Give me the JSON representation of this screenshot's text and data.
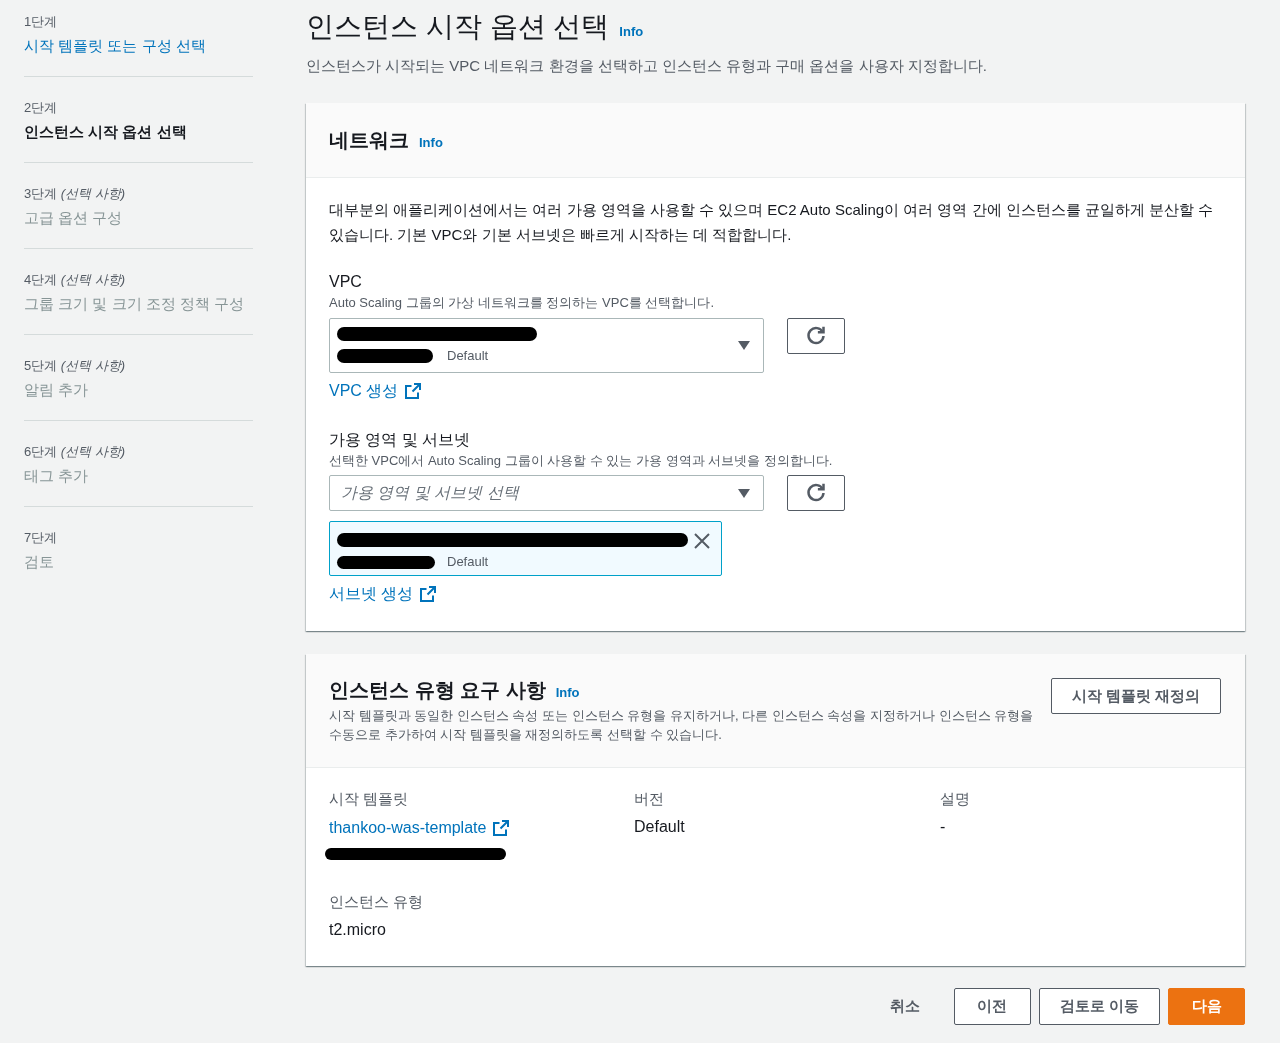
{
  "steps": [
    {
      "label": "1단계",
      "title": "시작 템플릿 또는 구성 선택",
      "selected": false,
      "disabled": false
    },
    {
      "label": "2단계",
      "title": "인스턴스 시작 옵션 선택",
      "selected": true,
      "disabled": false
    },
    {
      "label": "3단계",
      "optional_note": "(선택 사항)",
      "title": "고급 옵션 구성",
      "selected": false,
      "disabled": true
    },
    {
      "label": "4단계",
      "optional_note": "(선택 사항)",
      "title": "그룹 크기 및 크기 조정 정책 구성",
      "selected": false,
      "disabled": true
    },
    {
      "label": "5단계",
      "optional_note": "(선택 사항)",
      "title": "알림 추가",
      "selected": false,
      "disabled": true
    },
    {
      "label": "6단계",
      "optional_note": "(선택 사항)",
      "title": "태그 추가",
      "selected": false,
      "disabled": true
    },
    {
      "label": "7단계",
      "title": "검토",
      "selected": false,
      "disabled": true
    }
  ],
  "page": {
    "title": "인스턴스 시작 옵션 선택",
    "info": "Info",
    "description": "인스턴스가 시작되는 VPC 네트워크 환경을 선택하고 인스턴스 유형과 구매 옵션을 사용자 지정합니다."
  },
  "network": {
    "title": "네트워크",
    "info": "Info",
    "description": "대부분의 애플리케이션에서는 여러 가용 영역을 사용할 수 있으며 EC2 Auto Scaling이 여러 영역 간에 인스턴스를 균일하게 분산할 수 있습니다. 기본 VPC와 기본 서브넷은 빠르게 시작하는 데 적합합니다.",
    "vpc": {
      "label": "VPC",
      "description": "Auto Scaling 그룹의 가상 네트워크를 정의하는 VPC를 선택합니다.",
      "value_tag": "Default",
      "redacted": true,
      "create_link": "VPC 생성"
    },
    "subnets": {
      "label": "가용 영역 및 서브넷",
      "description": "선택한 VPC에서 Auto Scaling 그룹이 사용할 수 있는 가용 영역과 서브넷을 정의합니다.",
      "placeholder": "가용 영역 및 서브넷 선택",
      "selected": [
        {
          "tag": "Default",
          "redacted": true
        }
      ],
      "create_link": "서브넷 생성"
    }
  },
  "instance_type": {
    "title": "인스턴스 유형 요구 사항",
    "info": "Info",
    "description": "시작 템플릿과 동일한 인스턴스 속성 또는 인스턴스 유형을 유지하거나, 다른 인스턴스 속성을 지정하거나 인스턴스 유형을 수동으로 추가하여 시작 템플릿을 재정의하도록 선택할 수 있습니다.",
    "override_button": "시작 템플릿 재정의",
    "fields": [
      {
        "label": "시작 템플릿",
        "value": "thankoo-was-template",
        "kind": "link",
        "redacted_note": true
      },
      {
        "label": "버전",
        "value": "Default",
        "kind": "text"
      },
      {
        "label": "설명",
        "value": "-",
        "kind": "text"
      }
    ],
    "type_field": {
      "label": "인스턴스 유형",
      "value": "t2.micro"
    }
  },
  "footer": {
    "buttons": [
      {
        "label": "취소",
        "kind": "link"
      },
      {
        "label": "이전",
        "kind": "normal"
      },
      {
        "label": "검토로 이동",
        "kind": "normal"
      },
      {
        "label": "다음",
        "kind": "primary"
      }
    ]
  }
}
